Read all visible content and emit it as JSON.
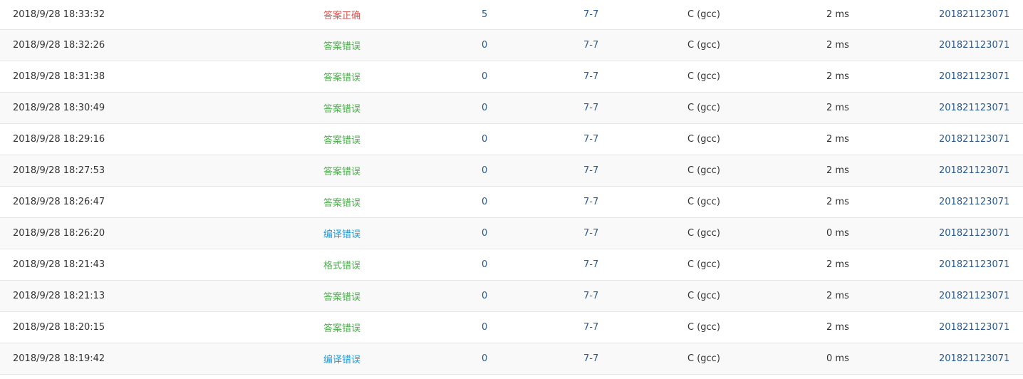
{
  "colors": {
    "accepted": "#d9534f",
    "wrong_answer": "#4cae4c",
    "compile_error": "#1e9bd7",
    "format_error": "#4cae4c",
    "link": "#2b5a8c"
  },
  "rows": [
    {
      "time": "2018/9/28 18:33:32",
      "status": "答案正确",
      "status_type": "accepted",
      "score": "5",
      "problem": "7-7",
      "compiler": "C (gcc)",
      "duration": "2 ms",
      "user": "201821123071"
    },
    {
      "time": "2018/9/28 18:32:26",
      "status": "答案错误",
      "status_type": "wrong_answer",
      "score": "0",
      "problem": "7-7",
      "compiler": "C (gcc)",
      "duration": "2 ms",
      "user": "201821123071"
    },
    {
      "time": "2018/9/28 18:31:38",
      "status": "答案错误",
      "status_type": "wrong_answer",
      "score": "0",
      "problem": "7-7",
      "compiler": "C (gcc)",
      "duration": "2 ms",
      "user": "201821123071"
    },
    {
      "time": "2018/9/28 18:30:49",
      "status": "答案错误",
      "status_type": "wrong_answer",
      "score": "0",
      "problem": "7-7",
      "compiler": "C (gcc)",
      "duration": "2 ms",
      "user": "201821123071"
    },
    {
      "time": "2018/9/28 18:29:16",
      "status": "答案错误",
      "status_type": "wrong_answer",
      "score": "0",
      "problem": "7-7",
      "compiler": "C (gcc)",
      "duration": "2 ms",
      "user": "201821123071"
    },
    {
      "time": "2018/9/28 18:27:53",
      "status": "答案错误",
      "status_type": "wrong_answer",
      "score": "0",
      "problem": "7-7",
      "compiler": "C (gcc)",
      "duration": "2 ms",
      "user": "201821123071"
    },
    {
      "time": "2018/9/28 18:26:47",
      "status": "答案错误",
      "status_type": "wrong_answer",
      "score": "0",
      "problem": "7-7",
      "compiler": "C (gcc)",
      "duration": "2 ms",
      "user": "201821123071"
    },
    {
      "time": "2018/9/28 18:26:20",
      "status": "编译错误",
      "status_type": "compile_error",
      "score": "0",
      "problem": "7-7",
      "compiler": "C (gcc)",
      "duration": "0 ms",
      "user": "201821123071"
    },
    {
      "time": "2018/9/28 18:21:43",
      "status": "格式错误",
      "status_type": "format_error",
      "score": "0",
      "problem": "7-7",
      "compiler": "C (gcc)",
      "duration": "2 ms",
      "user": "201821123071"
    },
    {
      "time": "2018/9/28 18:21:13",
      "status": "答案错误",
      "status_type": "wrong_answer",
      "score": "0",
      "problem": "7-7",
      "compiler": "C (gcc)",
      "duration": "2 ms",
      "user": "201821123071"
    },
    {
      "time": "2018/9/28 18:20:15",
      "status": "答案错误",
      "status_type": "wrong_answer",
      "score": "0",
      "problem": "7-7",
      "compiler": "C (gcc)",
      "duration": "2 ms",
      "user": "201821123071"
    },
    {
      "time": "2018/9/28 18:19:42",
      "status": "编译错误",
      "status_type": "compile_error",
      "score": "0",
      "problem": "7-7",
      "compiler": "C (gcc)",
      "duration": "0 ms",
      "user": "201821123071"
    }
  ]
}
